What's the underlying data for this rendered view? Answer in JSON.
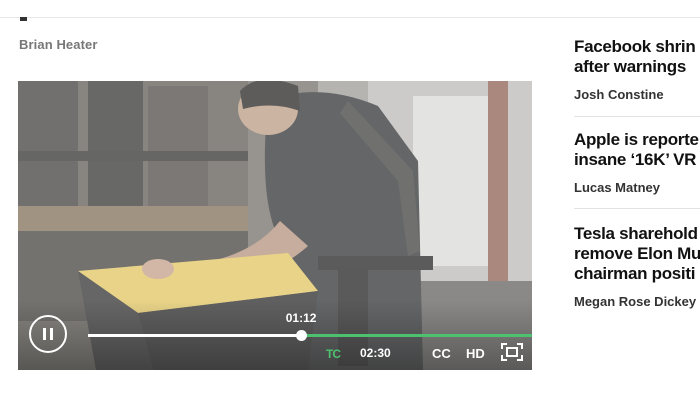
{
  "article": {
    "byline": "Brian Heater"
  },
  "player": {
    "current_time": "01:12",
    "duration": "02:30",
    "progress": 0.48,
    "buffered": 1.0,
    "brand_logo": "TC",
    "cc_label": "CC",
    "hd_label": "HD",
    "state": "playing",
    "accent_color": "#4ec16e"
  },
  "sidebar": {
    "stories": [
      {
        "headline_lines": [
          "Facebook shrin",
          "after warnings"
        ],
        "author": "Josh Constine"
      },
      {
        "headline_lines": [
          "Apple is reporte",
          "insane ‘16K’ VR"
        ],
        "author": "Lucas Matney"
      },
      {
        "headline_lines": [
          "Tesla sharehold",
          "remove Elon Mu",
          "chairman positi"
        ],
        "author": "Megan Rose Dickey"
      }
    ]
  }
}
